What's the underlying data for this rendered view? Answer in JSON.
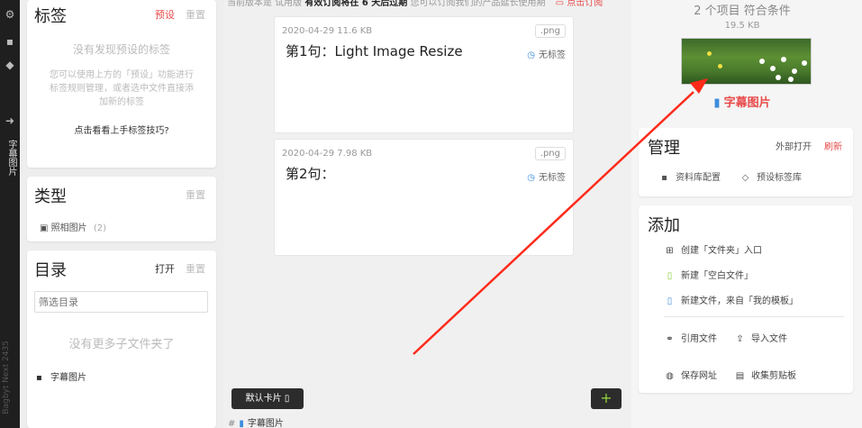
{
  "sidebar_strip": {
    "icons": [
      "gear-icon",
      "save-icon",
      "tag-icon",
      "arrow-right-icon"
    ],
    "vertical_text": "字幕图片",
    "version_text": "Bagbyt Next 2435"
  },
  "tags": {
    "title": "标签",
    "preset": "预设",
    "reset": "重置",
    "empty": "没有发现预设的标签",
    "help": "您可以使用上方的「预设」功能进行标签规则管理，或者选中文件直接添加新的标签",
    "tip": "点击看看上手标签技巧?"
  },
  "type_panel": {
    "title": "类型",
    "reset": "重置",
    "item_label": "照相图片",
    "item_count": "(2)"
  },
  "directory": {
    "title": "目录",
    "open": "打开",
    "reset": "重置",
    "filter_placeholder": "筛选目录",
    "empty": "没有更多子文件夹了",
    "folder": "字幕图片"
  },
  "notice": {
    "prefix": "当前版本是 试用版",
    "bold": "有效订阅将在 6 天后过期",
    "suffix": "您可以订阅我们的产品延长使用期",
    "subscribe": "点击订阅"
  },
  "cards": [
    {
      "meta": "2020-04-29  11.6 KB",
      "ext": ".png",
      "title": "第1句：Light Image Resize",
      "tag": "无标签"
    },
    {
      "meta": "2020-04-29  7.98 KB",
      "ext": ".png",
      "title": "第2句：",
      "tag": "无标签"
    }
  ],
  "footer": {
    "default_card": "默认卡片",
    "add": "+",
    "crumb_hash": "#",
    "crumb_folder": "字幕图片"
  },
  "summary": {
    "count": "2 个项目 符合条件",
    "size": "19.5 KB",
    "folder_link": "字幕图片"
  },
  "manage": {
    "title": "管理",
    "external_open": "外部打开",
    "refresh": "刷新",
    "library_config": "资料库配置",
    "preset_tags": "预设标签库"
  },
  "add_panel": {
    "title": "添加",
    "create_folder": "创建「文件夹」入口",
    "new_blank": "新建「空白文件」",
    "new_from_template": "新建文件，来自「我的模板」",
    "ref_file": "引用文件",
    "import_file": "导入文件",
    "save_url": "保存网址",
    "clipboard": "收集剪贴板"
  },
  "colors": {
    "accent_red": "#e84a4a",
    "file_blue": "#3c8ddb",
    "add_green": "#8bd13a",
    "annotation_arrow": "#ff2a1a"
  }
}
